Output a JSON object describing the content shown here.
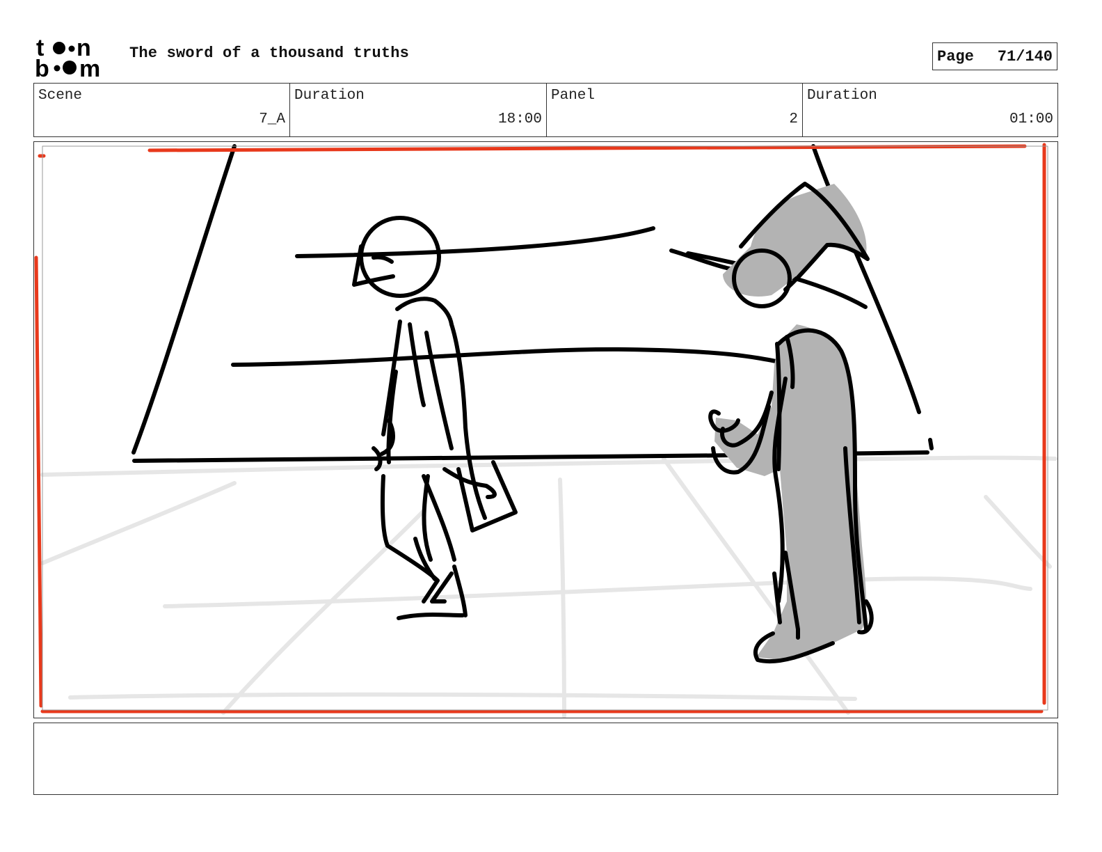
{
  "header": {
    "logo_text_top": "toon",
    "logo_text_bottom": "boom",
    "title": "The sword of a thousand truths",
    "page_label": "Page",
    "page_value": "71/140"
  },
  "info": {
    "scene_label": "Scene",
    "scene_value": "7_A",
    "scene_duration_label": "Duration",
    "scene_duration_value": "18:00",
    "panel_label": "Panel",
    "panel_value": "2",
    "panel_duration_label": "Duration",
    "panel_duration_value": "01:00"
  },
  "panel": {
    "sketch_colors": {
      "ink": "#000000",
      "floor_grid": "#e6e6e6",
      "safe_frame": "#e8391c",
      "shading": "#b3b3b3"
    }
  },
  "notes": {
    "text": ""
  }
}
